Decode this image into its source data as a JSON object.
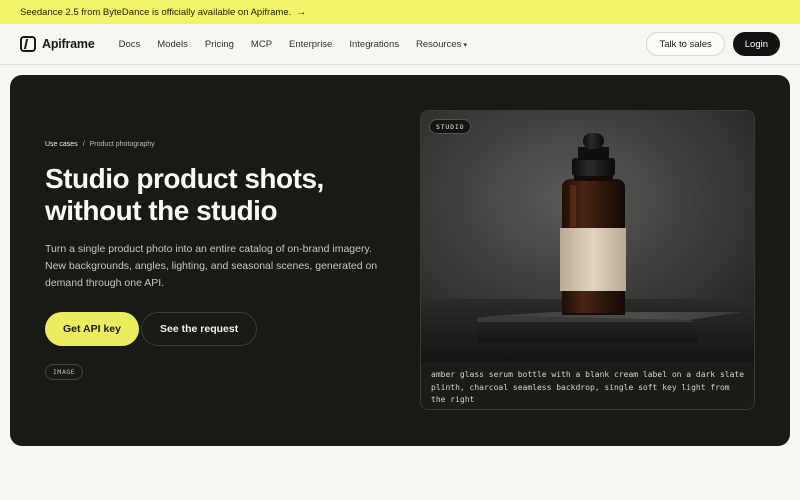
{
  "announcement": {
    "text": "Seedance 2.5 from ByteDance is officially available on Apiframe.",
    "arrow": "→"
  },
  "nav": {
    "brand": "Apiframe",
    "links": [
      "Docs",
      "Models",
      "Pricing",
      "MCP",
      "Enterprise",
      "Integrations",
      "Resources"
    ],
    "resources_chevron": "▾",
    "talk_to_sales": "Talk to sales",
    "login": "Login"
  },
  "hero": {
    "breadcrumb": [
      "Use cases",
      "/",
      "Product photography"
    ],
    "title": "Studio product shots, without the studio",
    "description": "Turn a single product photo into an entire catalog of on-brand imagery. New backgrounds, angles, lighting, and seasonal scenes, generated on demand through one API.",
    "primary_cta": "Get API key",
    "secondary_cta": "See the request",
    "type_tag": "IMAGE"
  },
  "preview": {
    "badge": "STUDIO",
    "prompt": "amber glass serum bottle with a blank cream label on a dark slate plinth, charcoal seamless backdrop, single soft key light from the right"
  },
  "colors": {
    "announcement_bg": "#f3f36a",
    "hero_bg": "#191915",
    "accent": "#ecec60",
    "page_bg": "#f7f7f2"
  }
}
